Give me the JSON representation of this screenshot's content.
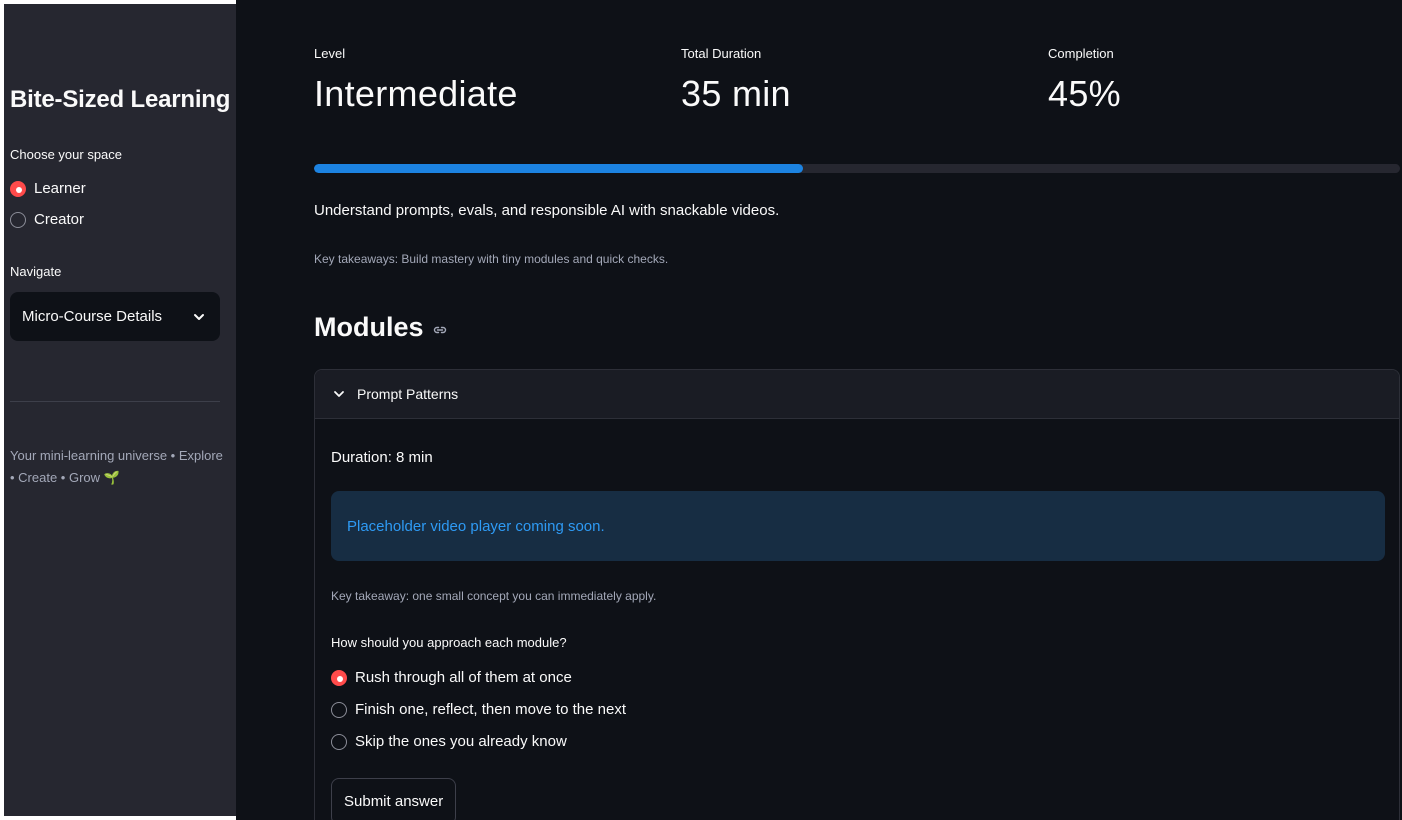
{
  "sidebar": {
    "title": "Bite-Sized Learning",
    "space_label": "Choose your space",
    "space_options": [
      {
        "label": "Learner",
        "checked": true
      },
      {
        "label": "Creator",
        "checked": false
      }
    ],
    "navigate_label": "Navigate",
    "navigate_value": "Micro-Course Details",
    "footer": "Your mini-learning universe • Explore • Create • Grow 🌱"
  },
  "metrics": [
    {
      "label": "Level",
      "value": "Intermediate"
    },
    {
      "label": "Total Duration",
      "value": "35 min"
    },
    {
      "label": "Completion",
      "value": "45%"
    }
  ],
  "progress": {
    "fraction": 0.45
  },
  "description": "Understand prompts, evals, and responsible AI with snackable videos.",
  "key_takeaways": "Key takeaways: Build mastery with tiny modules and quick checks.",
  "modules_heading": "Modules",
  "module": {
    "title": "Prompt Patterns",
    "duration": "Duration: 8 min",
    "info": "Placeholder video player coming soon.",
    "takeaway": "Key takeaway: one small concept you can immediately apply.",
    "question": "How should you approach each module?",
    "options": [
      {
        "label": "Rush through all of them at once",
        "checked": true
      },
      {
        "label": "Finish one, reflect, then move to the next",
        "checked": false
      },
      {
        "label": "Skip the ones you already know",
        "checked": false
      }
    ],
    "submit_label": "Submit answer"
  },
  "colors": {
    "accent_red": "#ff4b4b",
    "progress_blue": "#1c83e1",
    "info_text": "#2e9af4",
    "info_bg": "#172d43",
    "sidebar_bg": "#262730",
    "main_bg": "#0e1117"
  },
  "icons": {
    "select_chevron": "chevron-down-icon",
    "heading_link": "link-icon",
    "expander_chevron": "chevron-down-icon"
  }
}
